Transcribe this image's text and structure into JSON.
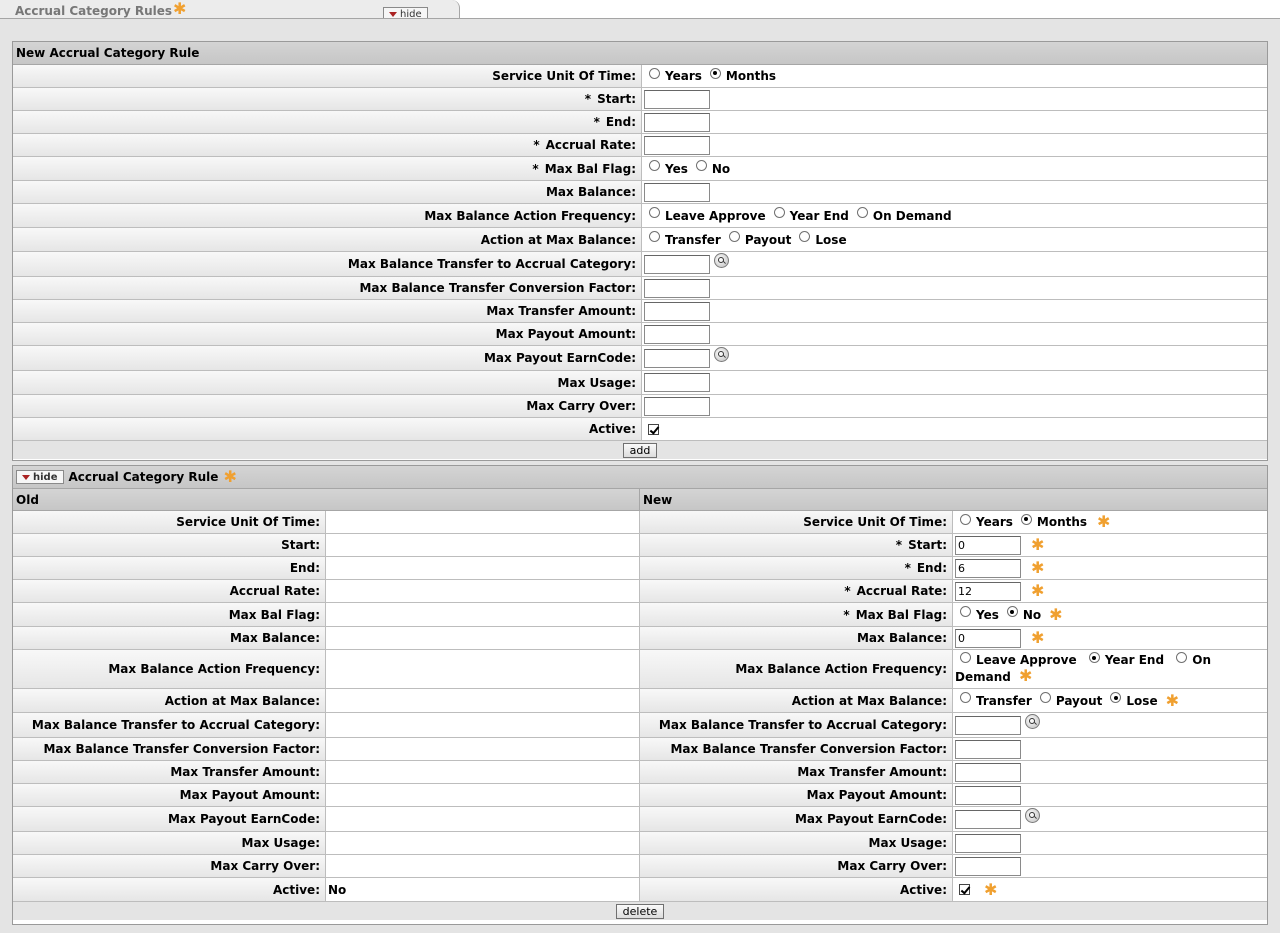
{
  "tab": {
    "title": "Accrual Category Rules",
    "hide_label": "hide"
  },
  "new_section": {
    "title": "New Accrual Category Rule",
    "labels": {
      "service_unit": "Service Unit Of Time:",
      "start": "Start:",
      "end": "End:",
      "accrual_rate": "Accrual Rate:",
      "max_bal_flag": "Max Bal Flag:",
      "max_balance": "Max Balance:",
      "max_bal_action_freq": "Max Balance Action Frequency:",
      "action_at_max": "Action at Max Balance:",
      "transfer_category": "Max Balance Transfer to Accrual Category:",
      "conversion_factor": "Max Balance Transfer Conversion Factor:",
      "max_transfer": "Max Transfer Amount:",
      "max_payout": "Max Payout Amount:",
      "payout_earncode": "Max Payout EarnCode:",
      "max_usage": "Max Usage:",
      "max_carry": "Max Carry Over:",
      "active": "Active:"
    },
    "required_mark": "*",
    "opts": {
      "years": "Years",
      "months": "Months",
      "yes": "Yes",
      "no": "No",
      "leave_approve": "Leave Approve",
      "year_end": "Year End",
      "on_demand": "On Demand",
      "transfer": "Transfer",
      "payout": "Payout",
      "lose": "Lose"
    },
    "selected": {
      "service_unit": "Months",
      "active": true
    },
    "add_label": "add"
  },
  "edit_section": {
    "hide_label": "hide",
    "title": "Accrual Category Rule",
    "col_old": "Old",
    "col_new": "New",
    "old_active_value": "No",
    "new_values": {
      "start": "0",
      "end": "6",
      "accrual_rate": "12",
      "max_balance": "0"
    },
    "opts": {
      "on": "On",
      "demand": "Demand"
    },
    "selected": {
      "service_unit": "Months",
      "max_bal_flag": "No",
      "action_freq": "Year End",
      "action_at_max": "Lose",
      "active": true
    },
    "delete_label": "delete"
  },
  "colors": {
    "required_star": "#f0a030",
    "header_bg": "#cccccc",
    "frame_bg": "#e4e4e4"
  }
}
